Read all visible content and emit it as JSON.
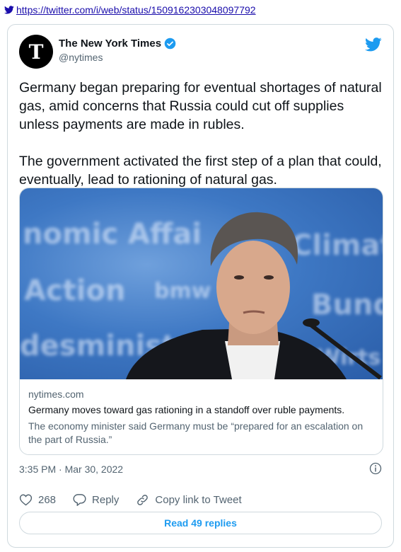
{
  "source": {
    "url": "https://twitter.com/i/web/status/1509162303048097792",
    "icon": "twitter-bird-icon"
  },
  "author": {
    "display_name": "The New York Times",
    "handle": "@nytimes",
    "verified": true,
    "avatar_glyph": "T"
  },
  "tweet": {
    "paragraphs": [
      "Germany began preparing for eventual shortages of natural gas, amid concerns that Russia could cut off supplies unless payments are made in rubles.",
      "The government activated the first step of a plan that could, eventually, lead to rationing of natural gas."
    ]
  },
  "link_card": {
    "domain": "nytimes.com",
    "title": "Germany moves toward gas rationing in a standoff over ruble payments.",
    "description": "The economy minister said Germany must be “prepared for an escalation on the part of Russia.”"
  },
  "timestamp": "3:35 PM · Mar 30, 2022",
  "actions": {
    "likes": "268",
    "reply_label": "Reply",
    "copy_label": "Copy link to Tweet"
  },
  "read_replies_label": "Read 49 replies",
  "colors": {
    "twitter_blue": "#1d9bf0",
    "text_secondary": "#536471",
    "border": "#cfd9de"
  }
}
